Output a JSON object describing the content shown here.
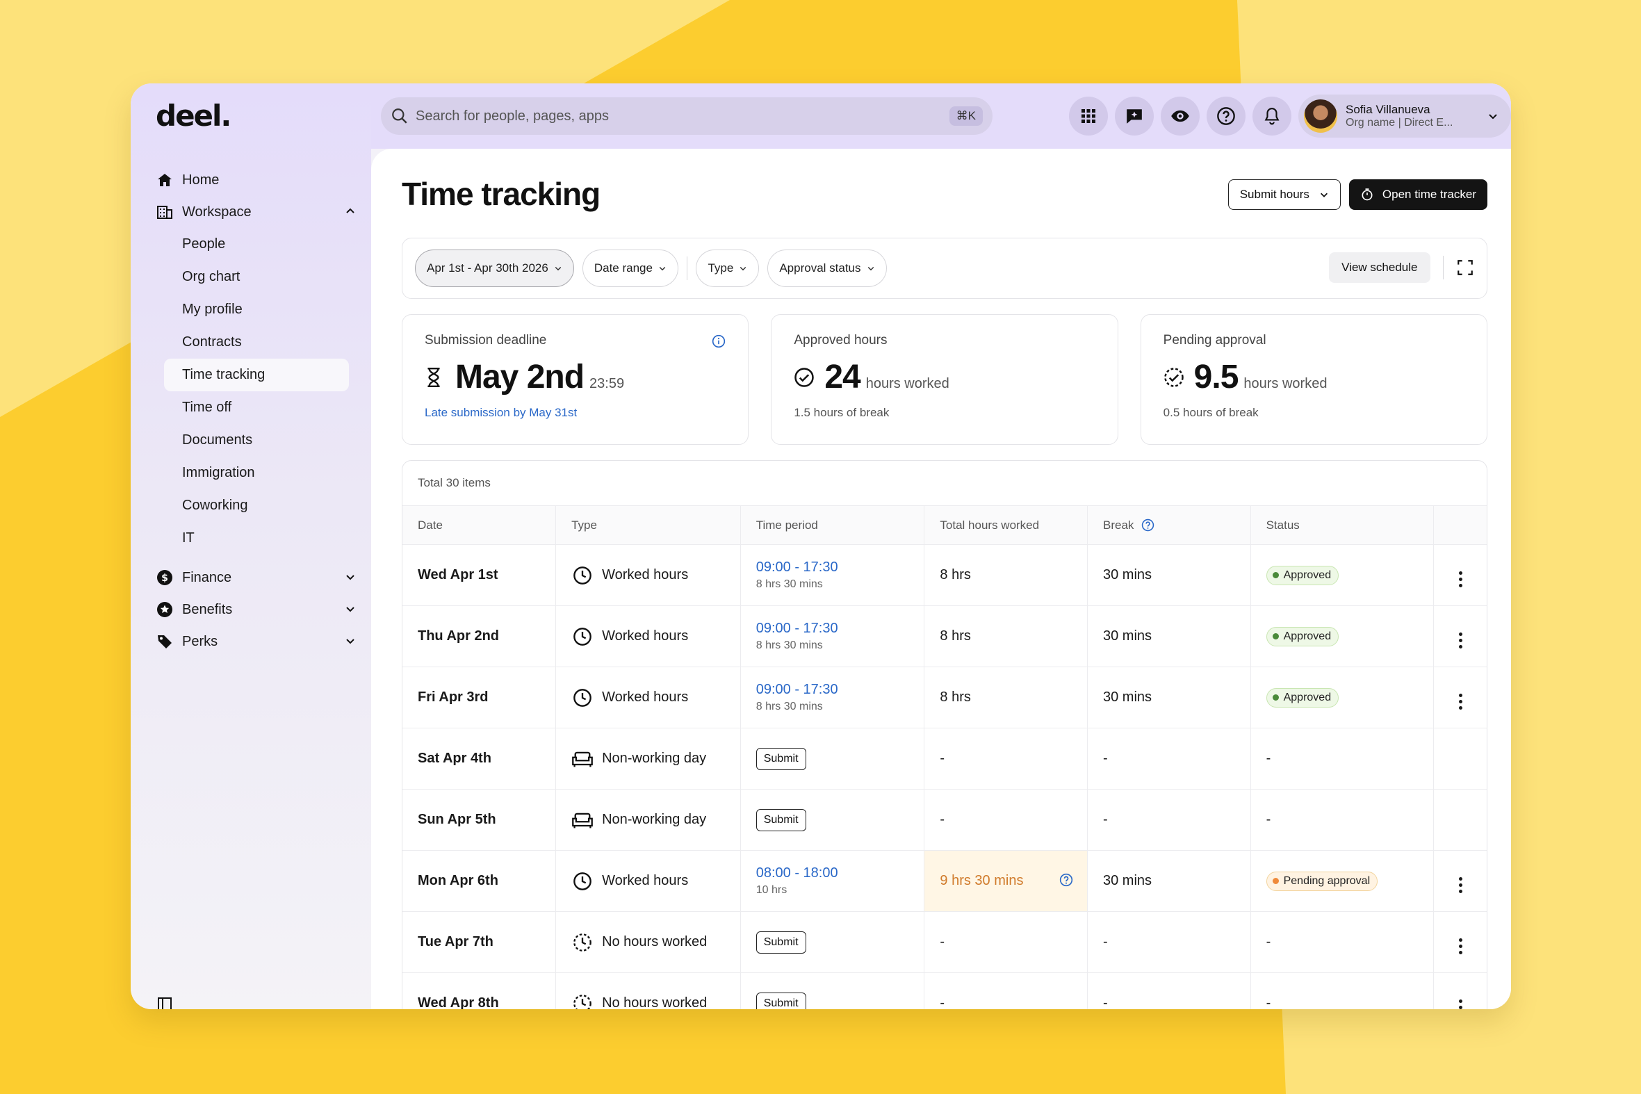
{
  "brand": {
    "logo": "deel."
  },
  "sidebar": {
    "items": [
      {
        "label": "Home",
        "icon": "home-icon"
      },
      {
        "label": "Workspace",
        "icon": "building-icon"
      }
    ],
    "workspace_sub": [
      {
        "label": "People"
      },
      {
        "label": "Org chart"
      },
      {
        "label": "My profile"
      },
      {
        "label": "Contracts"
      },
      {
        "label": "Time tracking",
        "active": true
      },
      {
        "label": "Time off"
      },
      {
        "label": "Documents"
      },
      {
        "label": "Immigration"
      },
      {
        "label": "Coworking"
      },
      {
        "label": "IT"
      }
    ],
    "groups": [
      {
        "label": "Finance",
        "icon": "dollar-icon"
      },
      {
        "label": "Benefits",
        "icon": "star-icon"
      },
      {
        "label": "Perks",
        "icon": "tag-icon"
      }
    ]
  },
  "topbar": {
    "search_placeholder": "Search for people, pages, apps",
    "shortcut": "⌘K",
    "user_name": "Sofia Villanueva",
    "user_org": "Org name | Direct E..."
  },
  "page": {
    "title": "Time tracking",
    "submit_hours_label": "Submit hours",
    "open_tracker_label": "Open time tracker"
  },
  "filters": {
    "date_chip": "Apr 1st - Apr 30th 2026",
    "date_range": "Date range",
    "type": "Type",
    "approval_status": "Approval status",
    "view_schedule": "View schedule"
  },
  "cards": {
    "deadline": {
      "label": "Submission deadline",
      "value": "May 2nd",
      "time": "23:59",
      "foot": "Late submission by May 31st"
    },
    "approved": {
      "label": "Approved hours",
      "value": "24",
      "suffix": "hours worked",
      "foot": "1.5 hours of break"
    },
    "pending": {
      "label": "Pending approval",
      "value": "9.5",
      "suffix": "hours worked",
      "foot": "0.5 hours of break"
    }
  },
  "table": {
    "total": "Total 30 items",
    "headers": {
      "date": "Date",
      "type": "Type",
      "period": "Time period",
      "total": "Total hours worked",
      "break": "Break",
      "status": "Status"
    },
    "submit_label": "Submit",
    "rows": [
      {
        "date": "Wed Apr 1st",
        "type": "Worked hours",
        "period": "09:00 - 17:30",
        "period_sub": "8 hrs 30 mins",
        "total": "8 hrs",
        "break": "30 mins",
        "status": "Approved"
      },
      {
        "date": "Thu Apr 2nd",
        "type": "Worked hours",
        "period": "09:00 - 17:30",
        "period_sub": "8 hrs 30 mins",
        "total": "8 hrs",
        "break": "30 mins",
        "status": "Approved"
      },
      {
        "date": "Fri Apr 3rd",
        "type": "Worked hours",
        "period": "09:00 - 17:30",
        "period_sub": "8 hrs 30 mins",
        "total": "8 hrs",
        "break": "30 mins",
        "status": "Approved"
      },
      {
        "date": "Sat Apr 4th",
        "type": "Non-working day",
        "total": "-",
        "break": "-",
        "status": "-"
      },
      {
        "date": "Sun Apr 5th",
        "type": "Non-working day",
        "total": "-",
        "break": "-",
        "status": "-"
      },
      {
        "date": "Mon Apr 6th",
        "type": "Worked hours",
        "period": "08:00 - 18:00",
        "period_sub": "10 hrs",
        "total": "9 hrs 30 mins",
        "break": "30 mins",
        "status": "Pending approval"
      },
      {
        "date": "Tue Apr 7th",
        "type": "No hours worked",
        "total": "-",
        "break": "-",
        "status": "-"
      },
      {
        "date": "Wed Apr 8th",
        "type": "No hours worked",
        "total": "-",
        "break": "-",
        "status": "-"
      }
    ]
  },
  "colors": {
    "accent_purple": "#e4dcfa",
    "link_blue": "#2a68c8",
    "warn_orange": "#d07a2a",
    "approved_green": "#4a8a3a",
    "background_yellow": "#fde27a"
  }
}
